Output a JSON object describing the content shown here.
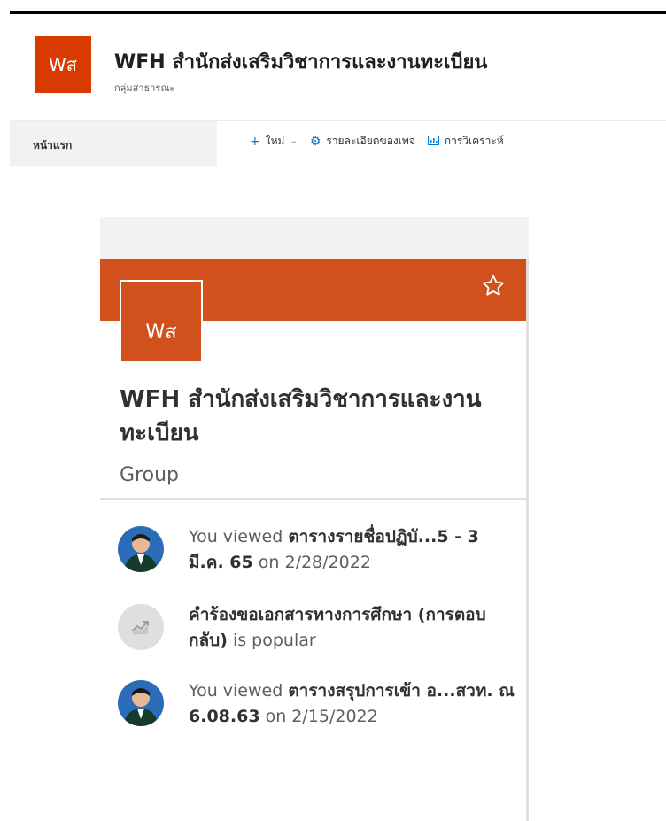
{
  "site": {
    "logo_text": "Wส",
    "title": "WFH สำนักส่งเสริมวิชาการและงานทะเบียน",
    "subtitle": "กลุ่มสาธารณะ"
  },
  "nav": {
    "home": "หน้าแรก",
    "commands": [
      {
        "label": "ใหม่",
        "icon": "plus-icon"
      },
      {
        "label": "รายละเอียดของเพจ",
        "icon": "gear-icon"
      },
      {
        "label": "การวิเคราะห์",
        "icon": "analytics-icon"
      }
    ]
  },
  "card": {
    "logo_text": "Wส",
    "title": "WFH สำนักส่งเสริมวิชาการและงานทะเบียน",
    "type": "Group",
    "activities": [
      {
        "prefix": "You viewed ",
        "bold": "ตารางรายชื่อปฏิบั...5 - 3 มี.ค. 65",
        "suffix": " on 2/28/2022",
        "icon": "avatar"
      },
      {
        "prefix": "",
        "bold": "คำร้องขอเอกสารทางการศึกษา (การตอบกลับ)",
        "suffix": " is popular",
        "icon": "trending-icon"
      },
      {
        "prefix": "You viewed ",
        "bold": "ตารางสรุปการเข้า อ...สวท. ณ 6.08.63",
        "suffix": " on 2/15/2022",
        "icon": "avatar"
      }
    ]
  },
  "colors": {
    "accent": "#d83b01",
    "banner": "#d2501c",
    "link": "#0078d4"
  }
}
